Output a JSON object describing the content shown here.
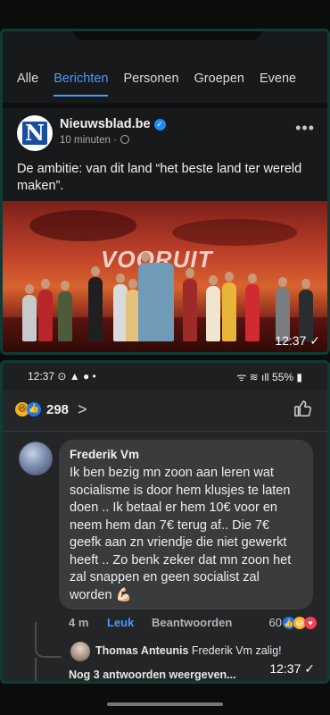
{
  "shot1": {
    "tabs": [
      "Alle",
      "Berichten",
      "Personen",
      "Groepen",
      "Evene"
    ],
    "active_tab": "Berichten",
    "post": {
      "page_name": "Nieuwsblad.be",
      "time": "10 minuten",
      "text": "De ambitie: van dit land “het beste land ter wereld maken”.",
      "avatar_letter": "N",
      "image_overlay_text": "VOORUIT"
    },
    "timestamp": "12:37 ✓"
  },
  "shot2": {
    "status": {
      "time": "12:37",
      "battery": "55%"
    },
    "reaction_count": "298",
    "comment": {
      "author": "Frederik Vm",
      "text": "Ik ben bezig mn zoon aan leren wat socialisme is door hem klusjes te laten doen .. Ik betaal er hem 10€ voor en neem hem dan 7€ terug af.. Die 7€ geefk aan zn vriendje die niet gewerkt heeft .. Zo benk zeker dat mn zoon het zal snappen en geen socialist zal worden 💪🏻",
      "time": "4 m",
      "like_label": "Leuk",
      "reply_label": "Beantwoorden",
      "reaction_count": "60"
    },
    "reply": {
      "author": "Thomas Anteunis",
      "text": "Frederik Vm zalig!"
    },
    "more_replies": "Nog 3 antwoorden weergeven...",
    "timestamp": "12:37 ✓"
  },
  "colors": {
    "accent": "#4599ff",
    "frame_border": "#0f3b35",
    "background": "#18191a"
  }
}
